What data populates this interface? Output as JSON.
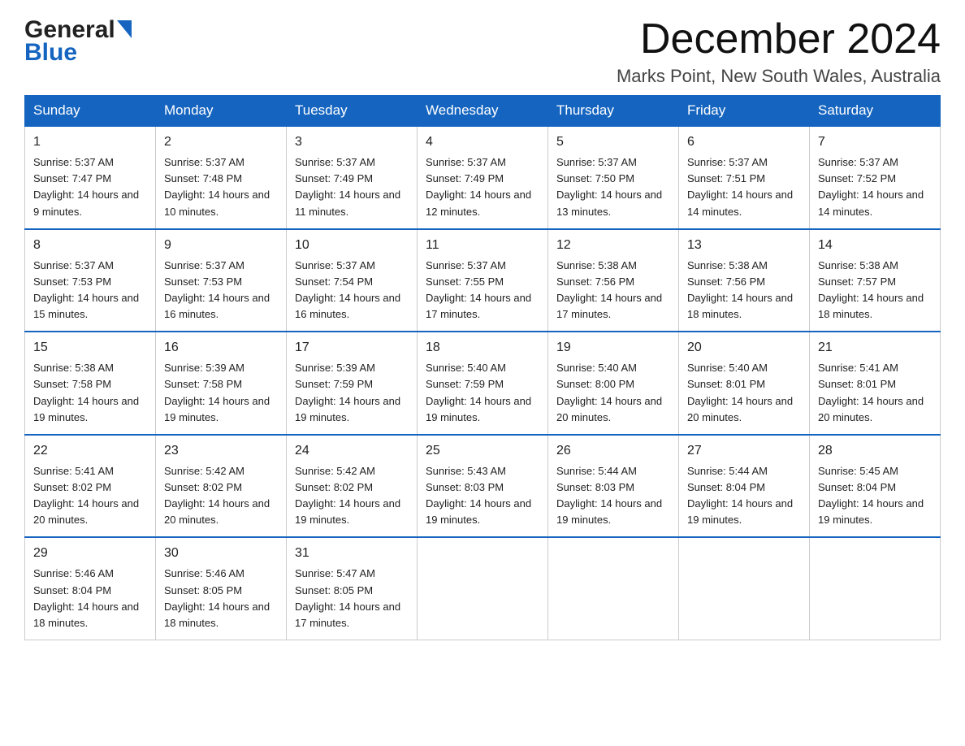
{
  "header": {
    "logo_general": "General",
    "logo_blue": "Blue",
    "month_year": "December 2024",
    "location": "Marks Point, New South Wales, Australia"
  },
  "days_of_week": [
    "Sunday",
    "Monday",
    "Tuesday",
    "Wednesday",
    "Thursday",
    "Friday",
    "Saturday"
  ],
  "weeks": [
    [
      {
        "day": "1",
        "sunrise": "5:37 AM",
        "sunset": "7:47 PM",
        "daylight": "14 hours and 9 minutes."
      },
      {
        "day": "2",
        "sunrise": "5:37 AM",
        "sunset": "7:48 PM",
        "daylight": "14 hours and 10 minutes."
      },
      {
        "day": "3",
        "sunrise": "5:37 AM",
        "sunset": "7:49 PM",
        "daylight": "14 hours and 11 minutes."
      },
      {
        "day": "4",
        "sunrise": "5:37 AM",
        "sunset": "7:49 PM",
        "daylight": "14 hours and 12 minutes."
      },
      {
        "day": "5",
        "sunrise": "5:37 AM",
        "sunset": "7:50 PM",
        "daylight": "14 hours and 13 minutes."
      },
      {
        "day": "6",
        "sunrise": "5:37 AM",
        "sunset": "7:51 PM",
        "daylight": "14 hours and 14 minutes."
      },
      {
        "day": "7",
        "sunrise": "5:37 AM",
        "sunset": "7:52 PM",
        "daylight": "14 hours and 14 minutes."
      }
    ],
    [
      {
        "day": "8",
        "sunrise": "5:37 AM",
        "sunset": "7:53 PM",
        "daylight": "14 hours and 15 minutes."
      },
      {
        "day": "9",
        "sunrise": "5:37 AM",
        "sunset": "7:53 PM",
        "daylight": "14 hours and 16 minutes."
      },
      {
        "day": "10",
        "sunrise": "5:37 AM",
        "sunset": "7:54 PM",
        "daylight": "14 hours and 16 minutes."
      },
      {
        "day": "11",
        "sunrise": "5:37 AM",
        "sunset": "7:55 PM",
        "daylight": "14 hours and 17 minutes."
      },
      {
        "day": "12",
        "sunrise": "5:38 AM",
        "sunset": "7:56 PM",
        "daylight": "14 hours and 17 minutes."
      },
      {
        "day": "13",
        "sunrise": "5:38 AM",
        "sunset": "7:56 PM",
        "daylight": "14 hours and 18 minutes."
      },
      {
        "day": "14",
        "sunrise": "5:38 AM",
        "sunset": "7:57 PM",
        "daylight": "14 hours and 18 minutes."
      }
    ],
    [
      {
        "day": "15",
        "sunrise": "5:38 AM",
        "sunset": "7:58 PM",
        "daylight": "14 hours and 19 minutes."
      },
      {
        "day": "16",
        "sunrise": "5:39 AM",
        "sunset": "7:58 PM",
        "daylight": "14 hours and 19 minutes."
      },
      {
        "day": "17",
        "sunrise": "5:39 AM",
        "sunset": "7:59 PM",
        "daylight": "14 hours and 19 minutes."
      },
      {
        "day": "18",
        "sunrise": "5:40 AM",
        "sunset": "7:59 PM",
        "daylight": "14 hours and 19 minutes."
      },
      {
        "day": "19",
        "sunrise": "5:40 AM",
        "sunset": "8:00 PM",
        "daylight": "14 hours and 20 minutes."
      },
      {
        "day": "20",
        "sunrise": "5:40 AM",
        "sunset": "8:01 PM",
        "daylight": "14 hours and 20 minutes."
      },
      {
        "day": "21",
        "sunrise": "5:41 AM",
        "sunset": "8:01 PM",
        "daylight": "14 hours and 20 minutes."
      }
    ],
    [
      {
        "day": "22",
        "sunrise": "5:41 AM",
        "sunset": "8:02 PM",
        "daylight": "14 hours and 20 minutes."
      },
      {
        "day": "23",
        "sunrise": "5:42 AM",
        "sunset": "8:02 PM",
        "daylight": "14 hours and 20 minutes."
      },
      {
        "day": "24",
        "sunrise": "5:42 AM",
        "sunset": "8:02 PM",
        "daylight": "14 hours and 19 minutes."
      },
      {
        "day": "25",
        "sunrise": "5:43 AM",
        "sunset": "8:03 PM",
        "daylight": "14 hours and 19 minutes."
      },
      {
        "day": "26",
        "sunrise": "5:44 AM",
        "sunset": "8:03 PM",
        "daylight": "14 hours and 19 minutes."
      },
      {
        "day": "27",
        "sunrise": "5:44 AM",
        "sunset": "8:04 PM",
        "daylight": "14 hours and 19 minutes."
      },
      {
        "day": "28",
        "sunrise": "5:45 AM",
        "sunset": "8:04 PM",
        "daylight": "14 hours and 19 minutes."
      }
    ],
    [
      {
        "day": "29",
        "sunrise": "5:46 AM",
        "sunset": "8:04 PM",
        "daylight": "14 hours and 18 minutes."
      },
      {
        "day": "30",
        "sunrise": "5:46 AM",
        "sunset": "8:05 PM",
        "daylight": "14 hours and 18 minutes."
      },
      {
        "day": "31",
        "sunrise": "5:47 AM",
        "sunset": "8:05 PM",
        "daylight": "14 hours and 17 minutes."
      },
      null,
      null,
      null,
      null
    ]
  ],
  "labels": {
    "sunrise": "Sunrise:",
    "sunset": "Sunset:",
    "daylight": "Daylight:"
  }
}
